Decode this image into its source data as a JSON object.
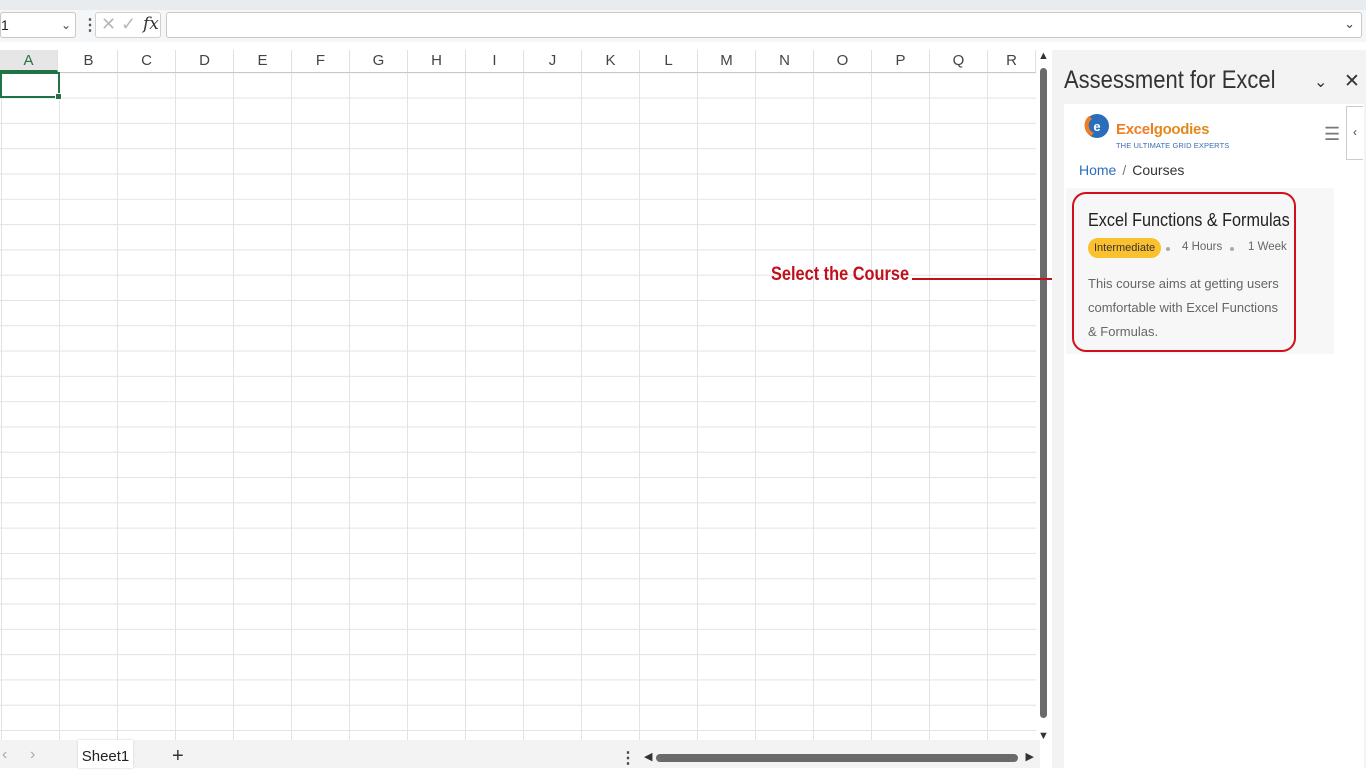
{
  "formula_bar": {
    "name_box": "1",
    "fx_label": "fx",
    "formula_value": ""
  },
  "grid": {
    "columns": [
      "A",
      "B",
      "C",
      "D",
      "E",
      "F",
      "G",
      "H",
      "I",
      "J",
      "K",
      "L",
      "M",
      "N",
      "O",
      "P",
      "Q",
      "R"
    ],
    "selected_column": "A"
  },
  "sheet_tabs": {
    "active_sheet": "Sheet1",
    "add_label": "+"
  },
  "task_pane": {
    "title": "Assessment for Excel",
    "brand": {
      "name_part1": "Excel",
      "name_part2": "goodies",
      "tagline": "THE ULTIMATE GRID EXPERTS"
    },
    "breadcrumb": {
      "home": "Home",
      "separator": "/",
      "current": "Courses"
    },
    "course": {
      "title": "Excel Functions & Formulas",
      "level": "Intermediate",
      "duration": "4 Hours",
      "length": "1 Week",
      "description": "This course aims at getting users comfortable with Excel Functions & Formulas."
    }
  },
  "annotation": {
    "text": "Select the Course",
    "color": "#c0101c"
  },
  "colors": {
    "excel_green": "#217346",
    "highlight_red": "#d0101d",
    "badge_yellow": "#fbc02d",
    "link_blue": "#2a6ebb"
  }
}
